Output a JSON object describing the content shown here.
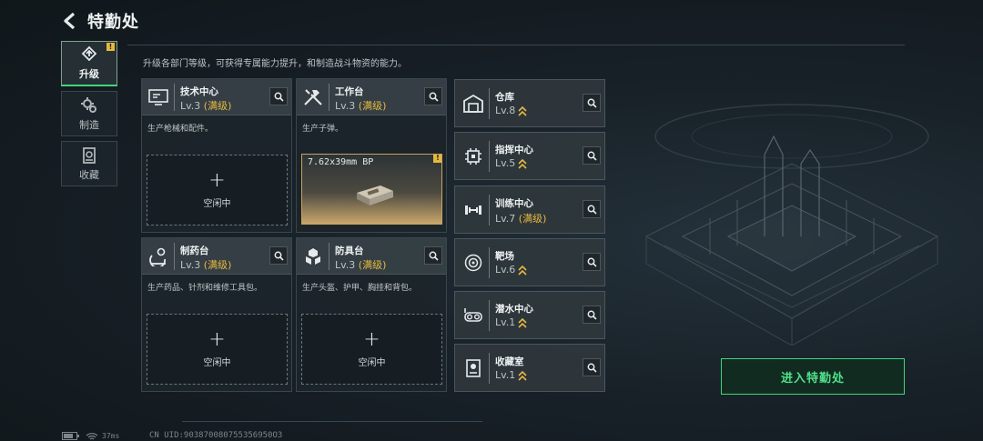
{
  "header": {
    "title": "特勤处",
    "back_icon": "back-arrow-icon"
  },
  "tabs": [
    {
      "label": "升级",
      "icon": "upgrade-icon",
      "active": true,
      "badge": "!"
    },
    {
      "label": "制造",
      "icon": "gears-icon",
      "active": false
    },
    {
      "label": "收藏",
      "icon": "collection-icon",
      "active": false
    }
  ],
  "description": "升级各部门等级，可获得专属能力提升，和制造战斗物资的能力。",
  "stations": [
    {
      "name": "技术中心",
      "level": "Lv.3",
      "max": "(满级)",
      "desc": "生产枪械和配件。",
      "slot_plus": "+",
      "slot_text": "空闲中",
      "icon": "tech-center-icon"
    },
    {
      "name": "工作台",
      "level": "Lv.3",
      "max": "(满级)",
      "desc": "生产子弹。",
      "product": "7.62x39mm BP",
      "product_badge": "!",
      "icon": "workbench-icon"
    },
    {
      "name": "制药台",
      "level": "Lv.3",
      "max": "(满级)",
      "desc": "生产药品、针剂和维修工具包。",
      "slot_plus": "+",
      "slot_text": "空闲中",
      "icon": "pharmacy-icon"
    },
    {
      "name": "防具台",
      "level": "Lv.3",
      "max": "(满级)",
      "desc": "生产头盔、护甲、胸挂和背包。",
      "slot_plus": "+",
      "slot_text": "空闲中",
      "icon": "armor-bench-icon"
    }
  ],
  "facilities": [
    {
      "name": "仓库",
      "level": "Lv.8",
      "icon": "warehouse-icon",
      "upgradable": true
    },
    {
      "name": "指挥中心",
      "level": "Lv.5",
      "icon": "command-center-icon",
      "upgradable": true
    },
    {
      "name": "训练中心",
      "level": "Lv.7",
      "max": "(满级)",
      "icon": "training-center-icon",
      "upgradable": true
    },
    {
      "name": "靶场",
      "level": "Lv.6",
      "icon": "shooting-range-icon",
      "upgradable": true
    },
    {
      "name": "潜水中心",
      "level": "Lv.1",
      "icon": "diving-center-icon",
      "upgradable": true
    },
    {
      "name": "收藏室",
      "level": "Lv.1",
      "icon": "collection-room-icon",
      "upgradable": true
    }
  ],
  "enter_button": "进入特勤处",
  "footer": {
    "ping": "37ms",
    "uid": "CN UID:903870080755356950O3"
  },
  "colors": {
    "accent_green": "#3fd67b",
    "max_gold": "#e7b93f",
    "badge_yellow": "#e5b93a"
  }
}
